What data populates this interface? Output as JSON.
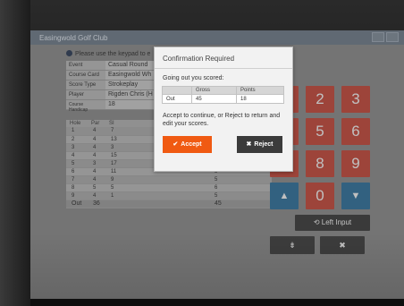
{
  "app": {
    "title": "Easingwold Golf Club",
    "instruction": "Please use the keypad to e"
  },
  "details": [
    {
      "label": "Event",
      "value": "Casual Round"
    },
    {
      "label": "Course Card",
      "value": "Easingwold Wh"
    },
    {
      "label": "Score Type",
      "value": "Strokeplay"
    },
    {
      "label": "Player",
      "value": "Rigden Chris (H"
    },
    {
      "label": "Course Handicap",
      "value": "18"
    }
  ],
  "scorecard": {
    "headers": [
      "Hole",
      "Par",
      "SI"
    ],
    "rows": [
      {
        "hole": "1",
        "par": "4",
        "si": "7",
        "pts": ""
      },
      {
        "hole": "2",
        "par": "4",
        "si": "13",
        "pts": ""
      },
      {
        "hole": "3",
        "par": "4",
        "si": "3",
        "pts": ""
      },
      {
        "hole": "4",
        "par": "4",
        "si": "15",
        "pts": ""
      },
      {
        "hole": "5",
        "par": "3",
        "si": "17",
        "pts": ""
      },
      {
        "hole": "6",
        "par": "4",
        "si": "11",
        "pts": "5"
      },
      {
        "hole": "7",
        "par": "4",
        "si": "9",
        "pts": "5"
      },
      {
        "hole": "8",
        "par": "5",
        "si": "5",
        "pts": "6"
      },
      {
        "hole": "9",
        "par": "4",
        "si": "1",
        "pts": "5"
      }
    ],
    "out": {
      "label": "Out",
      "par": "36",
      "pts": "45"
    }
  },
  "keypad": {
    "keys": [
      "1",
      "2",
      "3",
      "4",
      "5",
      "6",
      "7",
      "8",
      "9",
      "0"
    ],
    "up_glyph": "▲",
    "down_glyph": "▼",
    "left_input_label": "Left Input",
    "left_input_glyph": "⟲",
    "clear_glyph": "⇟",
    "delete_glyph": "✖",
    "colors": {
      "digit": "#c2473a",
      "arrow": "#2e6f9a"
    }
  },
  "modal": {
    "title": "Confirmation Required",
    "message": "Going out you scored:",
    "table_headers": [
      "",
      "Gross",
      "Points"
    ],
    "table_row": {
      "label": "Out",
      "gross": "45",
      "points": "18"
    },
    "prompt": "Accept to continue, or Reject to return and edit your scores.",
    "accept_label": "Accept",
    "accept_glyph": "✔",
    "reject_label": "Reject",
    "reject_glyph": "✖",
    "colors": {
      "accept": "#f05a12",
      "reject": "#3b3b3b"
    }
  }
}
